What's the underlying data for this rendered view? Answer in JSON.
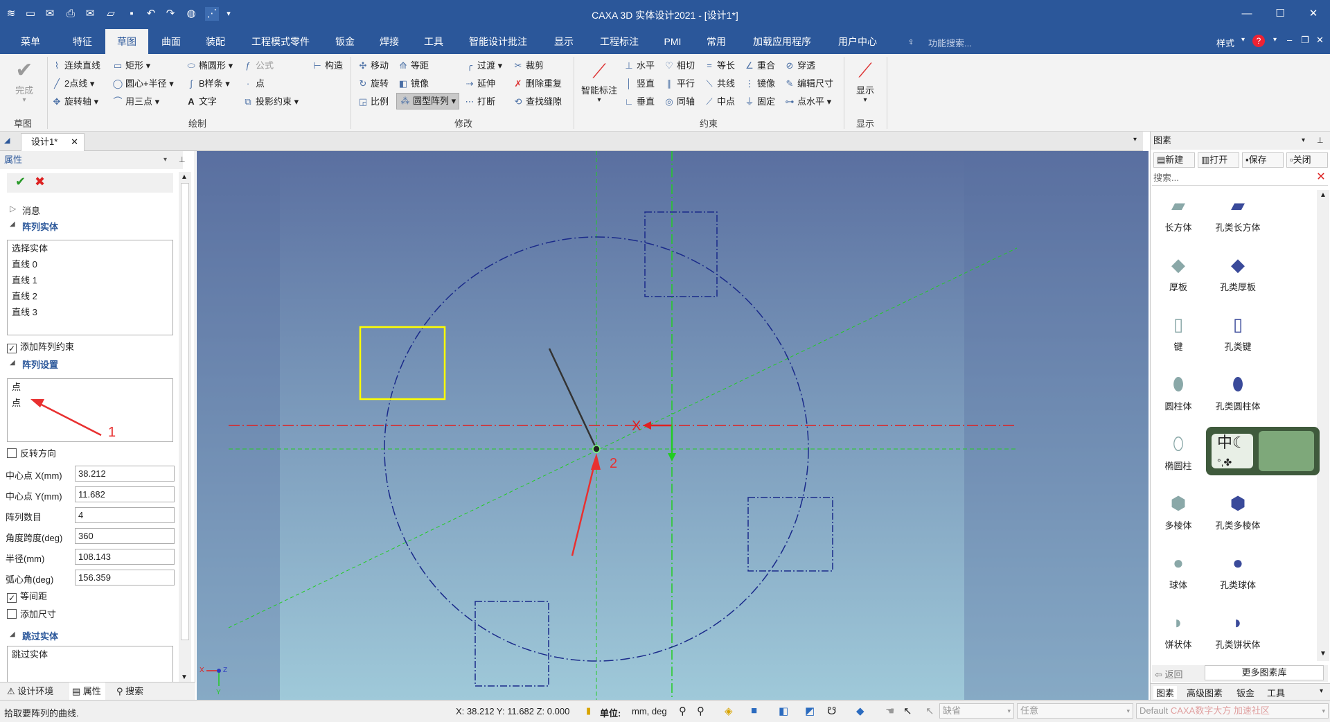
{
  "titlebar": {
    "title": "CAXA 3D 实体设计2021 - [设计1*]",
    "minimize": "—",
    "maximize": "☐",
    "close": "✕"
  },
  "menubar": {
    "tabs": [
      "菜单",
      "特征",
      "草图",
      "曲面",
      "装配",
      "工程模式零件",
      "钣金",
      "焊接",
      "工具",
      "智能设计批注",
      "显示",
      "工程标注",
      "PMI",
      "常用",
      "加载应用程序",
      "用户中心"
    ],
    "active_tab": "草图",
    "search_placeholder": "功能搜索...",
    "style_label": "样式"
  },
  "ribbon": {
    "finish": {
      "label": "完成",
      "group": "草图"
    },
    "draw": {
      "group": "绘制",
      "items": [
        "连续直线",
        "矩形",
        "椭圆形",
        "公式",
        "构造",
        "2点线",
        "圆心+半径",
        "B样条",
        "点",
        "旋转轴",
        "用三点",
        "文字",
        "投影约束"
      ]
    },
    "modify": {
      "group": "修改",
      "items": [
        "移动",
        "等距",
        "过渡",
        "裁剪",
        "旋转",
        "镜像",
        "延伸",
        "删除重复",
        "比例",
        "圆型阵列",
        "打断",
        "查找缝隙"
      ]
    },
    "smart_dim": "智能标注",
    "constraint": {
      "group": "约束",
      "items": [
        "水平",
        "相切",
        "等长",
        "重合",
        "穿透",
        "竖直",
        "平行",
        "共线",
        "镜像",
        "编辑尺寸",
        "垂直",
        "同轴",
        "中点",
        "固定",
        "点水平"
      ]
    },
    "display": {
      "label": "显示",
      "group": "显示"
    }
  },
  "doc_tab": {
    "label": "设计1*",
    "close": "✕"
  },
  "properties": {
    "header": "属性",
    "message_section": "消息",
    "array_entity_section": "阵列实体",
    "array_entities": [
      "选择实体",
      "直线 0",
      "直线 1",
      "直线 2",
      "直线 3"
    ],
    "add_array_constraint": {
      "label": "添加阵列约束",
      "checked": true
    },
    "array_settings_section": "阵列设置",
    "array_points": [
      "点",
      "点"
    ],
    "annotation_1": "1",
    "reverse_direction": {
      "label": "反转方向",
      "checked": false
    },
    "fields": [
      {
        "label": "中心点 X(mm)",
        "value": "38.212"
      },
      {
        "label": "中心点 Y(mm)",
        "value": "11.682"
      },
      {
        "label": "阵列数目",
        "value": "4"
      },
      {
        "label": "角度跨度(deg)",
        "value": "360"
      },
      {
        "label": "半径(mm)",
        "value": "108.143"
      },
      {
        "label": "弧心角(deg)",
        "value": "156.359"
      }
    ],
    "equal_spacing": {
      "label": "等间距",
      "checked": true
    },
    "add_dimension": {
      "label": "添加尺寸",
      "checked": false
    },
    "skip_entity_section": "跳过实体",
    "skip_entities": [
      "跳过实体"
    ],
    "bottom_tabs": [
      "设计环境",
      "属性",
      "搜索"
    ]
  },
  "canvas": {
    "annotation_2": "2",
    "axis_x_label": "X",
    "triad_x": "X",
    "triad_z": "Z",
    "triad_y": "Y",
    "colors": {
      "background_top": "#5a6fa0",
      "background_bottom": "#9fc9d9",
      "circle": "#1a2a8a",
      "selected": "#ffff00",
      "axis_red": "#e02020",
      "axis_green": "#22cc22",
      "annotation": "#e83030"
    }
  },
  "library": {
    "header": "图素",
    "buttons": [
      "新建",
      "打开",
      "保存",
      "关闭"
    ],
    "search_placeholder": "搜索...",
    "items": [
      [
        "长方体",
        "孔类长方体"
      ],
      [
        "厚板",
        "孔类厚板"
      ],
      [
        "键",
        "孔类键"
      ],
      [
        "圆柱体",
        "孔类圆柱体"
      ],
      [
        "椭圆柱",
        ""
      ],
      [
        "多棱体",
        "孔类多棱体"
      ],
      [
        "球体",
        "孔类球体"
      ],
      [
        "饼状体",
        "孔类饼状体"
      ]
    ],
    "back": "返回",
    "more": "更多图素库",
    "bottom_tabs": [
      "图素",
      "高级图素",
      "钣金",
      "工具"
    ]
  },
  "statusbar": {
    "hint": "拾取要阵列的曲线.",
    "coords": "X: 38.212 Y: 11.682 Z: 0.000",
    "unit_label": "单位:",
    "unit_value": "mm, deg",
    "combo1": "缺省",
    "combo2": "任意",
    "combo3": "Default",
    "watermark": "CAXA数字大方 加速社区"
  }
}
